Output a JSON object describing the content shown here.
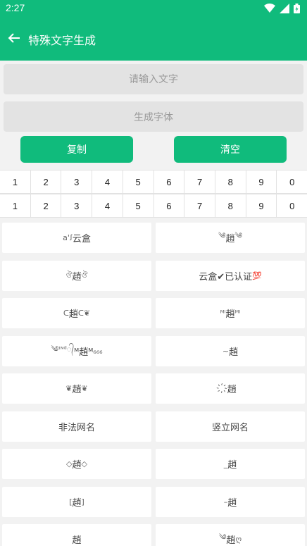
{
  "status": {
    "time": "2:27"
  },
  "header": {
    "title": "特殊文字生成"
  },
  "input": {
    "placeholder": "请输入文字"
  },
  "generate": {
    "label": "生成字体"
  },
  "buttons": {
    "copy": "复制",
    "clear": "清空"
  },
  "numbers_row1": [
    "1",
    "2",
    "3",
    "4",
    "5",
    "6",
    "7",
    "8",
    "9",
    "0"
  ],
  "numbers_row2": [
    "1",
    "2",
    "3",
    "4",
    "5",
    "6",
    "7",
    "8",
    "9",
    "0"
  ],
  "styles": [
    {
      "pre": "a'ꭍ",
      "main": "云盒",
      "post": ""
    },
    {
      "pre": "༄",
      "main": "趙",
      "post": "༄"
    },
    {
      "pre": "ঔ",
      "main": "趙",
      "post": "ঔ"
    },
    {
      "pre": "",
      "main": "云盒✔已认证",
      "post": "💯"
    },
    {
      "pre": "ᑕ",
      "main": "趙",
      "post": "ᑕ❦"
    },
    {
      "pre": "ᴹˡ",
      "main": "趙",
      "post": "ᴹˡ"
    },
    {
      "pre": "༄ᶦᶰᵈ᭄",
      "main": "ᴹ趙ᴹ",
      "post": "₆₆₆"
    },
    {
      "pre": "~",
      "main": "趙",
      "post": ""
    },
    {
      "pre": "❦",
      "main": "趙",
      "post": "❦"
    },
    {
      "pre": "҉",
      "main": "趙",
      "post": ""
    },
    {
      "pre": "",
      "main": "非法网名",
      "post": ""
    },
    {
      "pre": "",
      "main": "竖立网名",
      "post": ""
    },
    {
      "pre": "◇",
      "main": "趙",
      "post": "◇"
    },
    {
      "pre": "_",
      "main": "趙",
      "post": ""
    },
    {
      "pre": "[",
      "main": "趙",
      "post": "]"
    },
    {
      "pre": "–",
      "main": "趙",
      "post": ""
    },
    {
      "pre": "",
      "main": "趙",
      "post": ""
    },
    {
      "pre": "༄",
      "main": "趙",
      "post": "ღ"
    }
  ]
}
